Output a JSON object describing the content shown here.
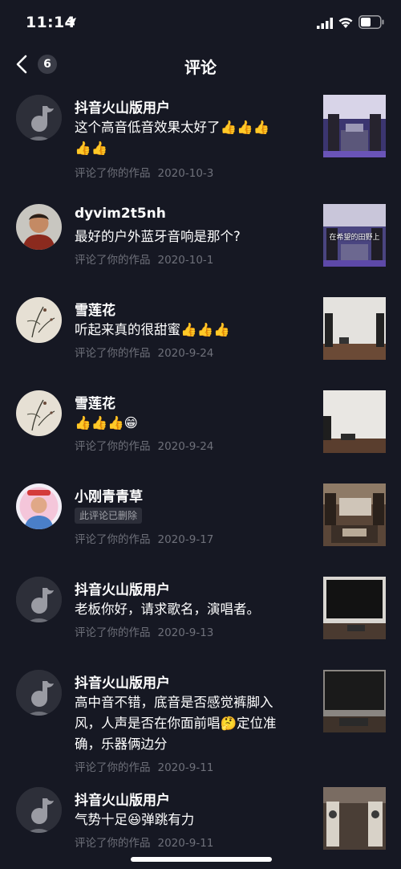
{
  "status_bar": {
    "time": "11:14"
  },
  "nav": {
    "badge_count": "6",
    "title": "评论"
  },
  "action_text": "评论了你的作品",
  "items": [
    {
      "name": "抖音火山版用户",
      "line1": "这个高音低音效果太好了👍👍👍",
      "line2": "👍👍",
      "deleted": "",
      "date": "2020-10-3"
    },
    {
      "name": "dyvim2t5nh",
      "line1": "最好的户外蓝牙音响是那个?",
      "line2": "",
      "deleted": "",
      "date": "2020-10-1",
      "thumb_label": "在希望的田野上"
    },
    {
      "name": "雪莲花",
      "line1": "听起来真的很甜蜜👍👍👍",
      "line2": "",
      "deleted": "",
      "date": "2020-9-24"
    },
    {
      "name": "雪莲花",
      "line1": "👍👍👍😁",
      "line2": "",
      "deleted": "",
      "date": "2020-9-24"
    },
    {
      "name": "小刚青青草",
      "line1": "",
      "line2": "",
      "deleted": "此评论已删除",
      "date": "2020-9-17"
    },
    {
      "name": "抖音火山版用户",
      "line1": "老板你好，请求歌名，演唱者。",
      "line2": "",
      "deleted": "",
      "date": "2020-9-13"
    },
    {
      "name": "抖音火山版用户",
      "line1": "高中音不错，底音是否感觉裤脚入",
      "line2": "风，人声是否在你面前唱🤔定位准",
      "line3": "确，乐器俩边分",
      "deleted": "",
      "date": "2020-9-11"
    },
    {
      "name": "抖音火山版用户",
      "line1": "气势十足😆弹跳有力",
      "line2": "",
      "deleted": "",
      "date": "2020-9-11"
    }
  ]
}
